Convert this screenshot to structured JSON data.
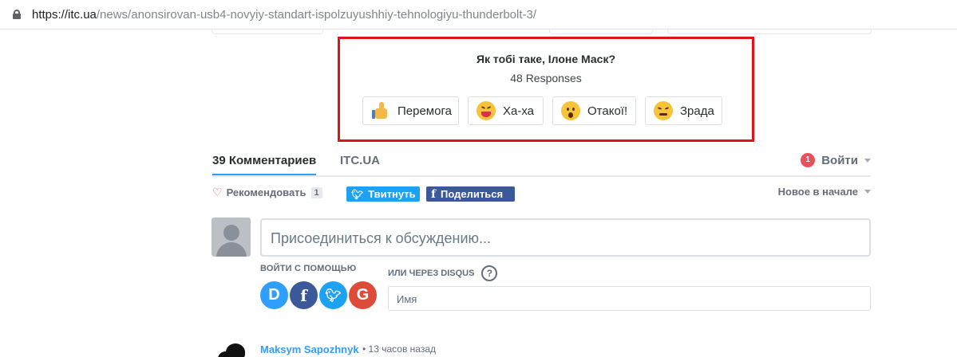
{
  "browser": {
    "url_host": "https://itc.ua",
    "url_path": "/news/anonsirovan-usb4-novyiy-standart-ispolzuyushhiy-tehnologiyu-thunderbolt-3/"
  },
  "reactions": {
    "title": "Як тобі таке, Ілоне Маск?",
    "responses": "48 Responses",
    "buttons": [
      {
        "label": "Перемога",
        "icon": "thumbs-up-icon"
      },
      {
        "label": "Ха-ха",
        "icon": "laughing-emoji-icon"
      },
      {
        "label": "Отакої!",
        "icon": "surprised-emoji-icon"
      },
      {
        "label": "Зрада",
        "icon": "angry-emoji-icon"
      }
    ],
    "highlight_color": "#e0131b"
  },
  "comments": {
    "tabs": [
      {
        "label": "39 Комментариев",
        "active": true
      },
      {
        "label": "ITC.UA",
        "active": false
      }
    ],
    "login_label": "Войти",
    "notification_count": "1",
    "recommend_label": "Рекомендовать",
    "recommend_count": "1",
    "tweet_label": "Твитнуть",
    "share_label": "Поделиться",
    "sort_label": "Новое в начале",
    "composer_placeholder": "Присоединиться к обсуждению...",
    "login_with_label": "ВОЙТИ С ПОМОЩЬЮ",
    "social_logins": [
      "disqus",
      "facebook",
      "twitter",
      "google"
    ],
    "via_disqus_label": "ИЛИ ЧЕРЕЗ DISQUS",
    "help_mark": "?",
    "name_placeholder": "Имя",
    "first_comment": {
      "author": "Maksym Sapozhnyk",
      "time": "• 13 часов назад"
    }
  },
  "colors": {
    "accent": "#2e9fff",
    "twitter": "#1da1f2",
    "facebook": "#3b5998",
    "google": "#dd4b39"
  }
}
